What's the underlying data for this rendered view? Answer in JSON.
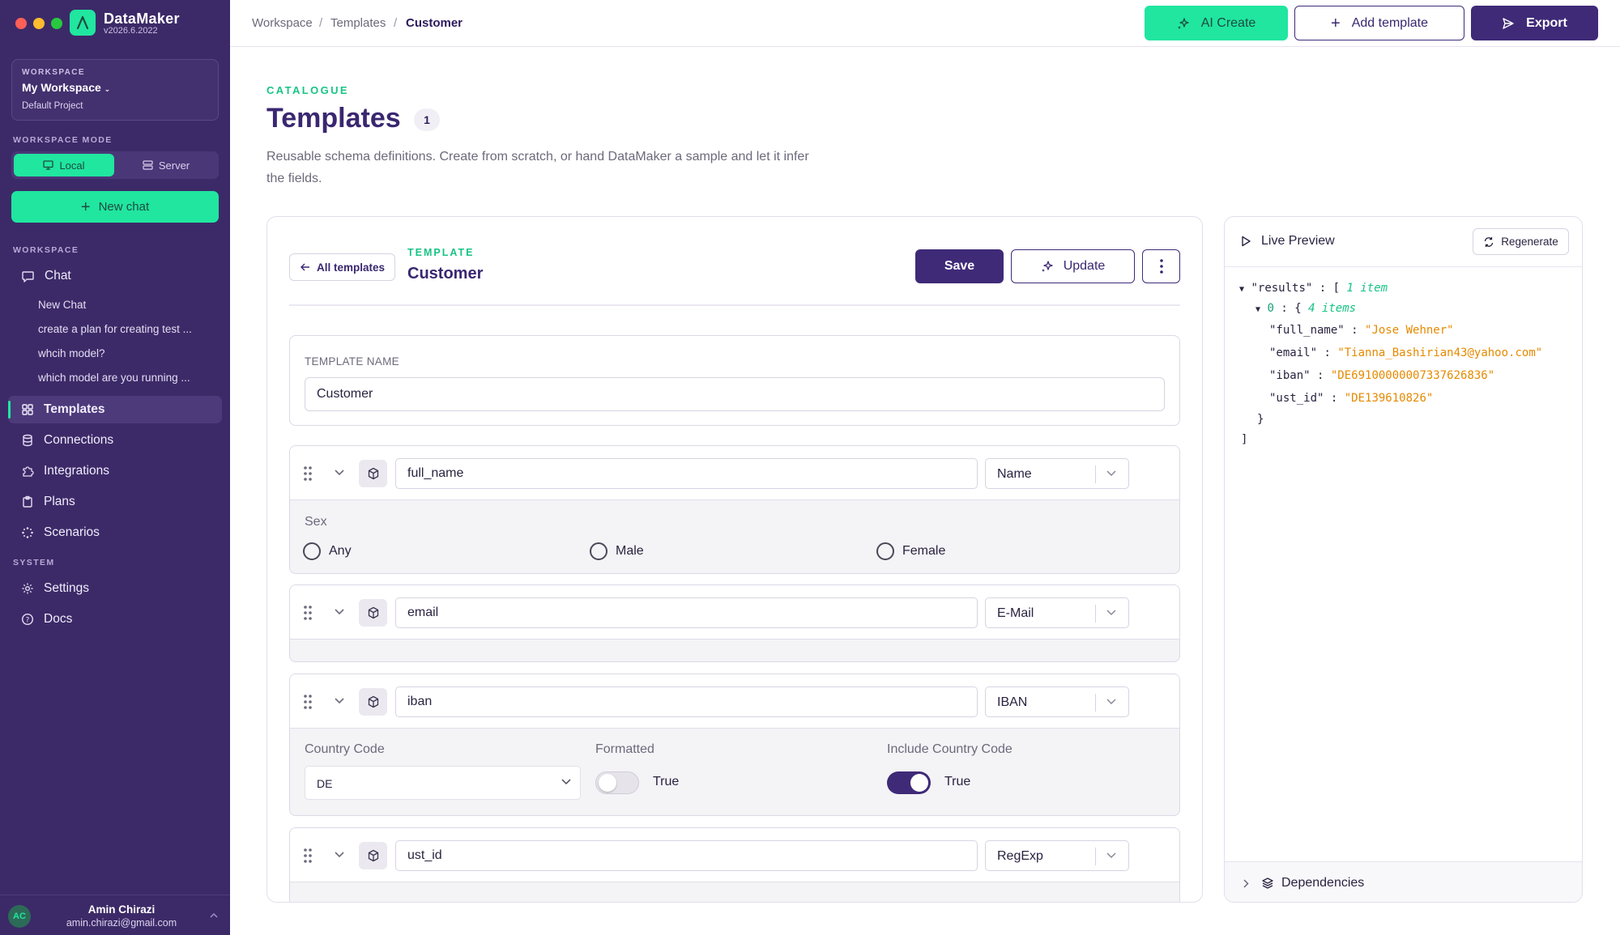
{
  "app": {
    "name": "DataMaker",
    "version": "v2026.6.2022"
  },
  "workspace": {
    "label": "WORKSPACE",
    "name": "My Workspace",
    "project": "Default Project"
  },
  "mode": {
    "label": "WORKSPACE MODE",
    "local": "Local",
    "server": "Server",
    "selected": "Local"
  },
  "new_chat": "New chat",
  "sidebar": {
    "workspace_section": "WORKSPACE",
    "chat": "Chat",
    "chats": [
      "New Chat",
      "create a plan for creating test ...",
      "whcih model?",
      "which model are you running ..."
    ],
    "items": [
      "Templates",
      "Connections",
      "Integrations",
      "Plans",
      "Scenarios"
    ],
    "active": "Templates",
    "system_section": "SYSTEM",
    "system_items": [
      "Settings",
      "Docs"
    ]
  },
  "user": {
    "initials": "AC",
    "name": "Amin Chirazi",
    "email": "amin.chirazi@gmail.com"
  },
  "breadcrumb": [
    "Workspace",
    "Templates",
    "Customer"
  ],
  "topbar": {
    "ai_create": "AI Create",
    "add_template": "Add template",
    "export": "Export"
  },
  "page": {
    "eyebrow": "CATALOGUE",
    "title": "Templates",
    "count": "1",
    "description": "Reusable schema definitions. Create from scratch, or hand DataMaker a sample and let it infer the fields."
  },
  "editor": {
    "back": "All templates",
    "label": "TEMPLATE",
    "name": "Customer",
    "save": "Save",
    "update": "Update",
    "name_field_label": "TEMPLATE NAME",
    "name_field_value": "Customer"
  },
  "fields": [
    {
      "name": "full_name",
      "type": "Name",
      "option_label": "Sex",
      "options": [
        "Any",
        "Male",
        "Female"
      ]
    },
    {
      "name": "email",
      "type": "E-Mail"
    },
    {
      "name": "iban",
      "type": "IBAN",
      "country_code_label": "Country Code",
      "country_code": "DE",
      "formatted_label": "Formatted",
      "formatted": false,
      "formatted_text": "True",
      "include_cc_label": "Include Country Code",
      "include_cc": true,
      "include_cc_text": "True"
    },
    {
      "name": "ust_id",
      "type": "RegExp"
    }
  ],
  "preview": {
    "title": "Live Preview",
    "regenerate": "Regenerate",
    "root_key": "\"results\"",
    "root_open": "[",
    "root_count": "1 item",
    "item_index": "0",
    "item_open": "{",
    "item_count": "4 items",
    "rows": [
      {
        "key": "\"full_name\"",
        "value": "\"Jose Wehner\""
      },
      {
        "key": "\"email\"",
        "value": "\"Tianna_Bashirian43@yahoo.com\""
      },
      {
        "key": "\"iban\"",
        "value": "\"DE69100000007337626836\""
      },
      {
        "key": "\"ust_id\"",
        "value": "\"DE139610826\""
      }
    ],
    "item_close": "}",
    "root_close": "]",
    "dependencies": "Dependencies"
  },
  "colors": {
    "sidebar": "#3c2a68",
    "accent": "#20e6a0",
    "primary": "#3f2a78",
    "json_string": "#e58a00"
  }
}
